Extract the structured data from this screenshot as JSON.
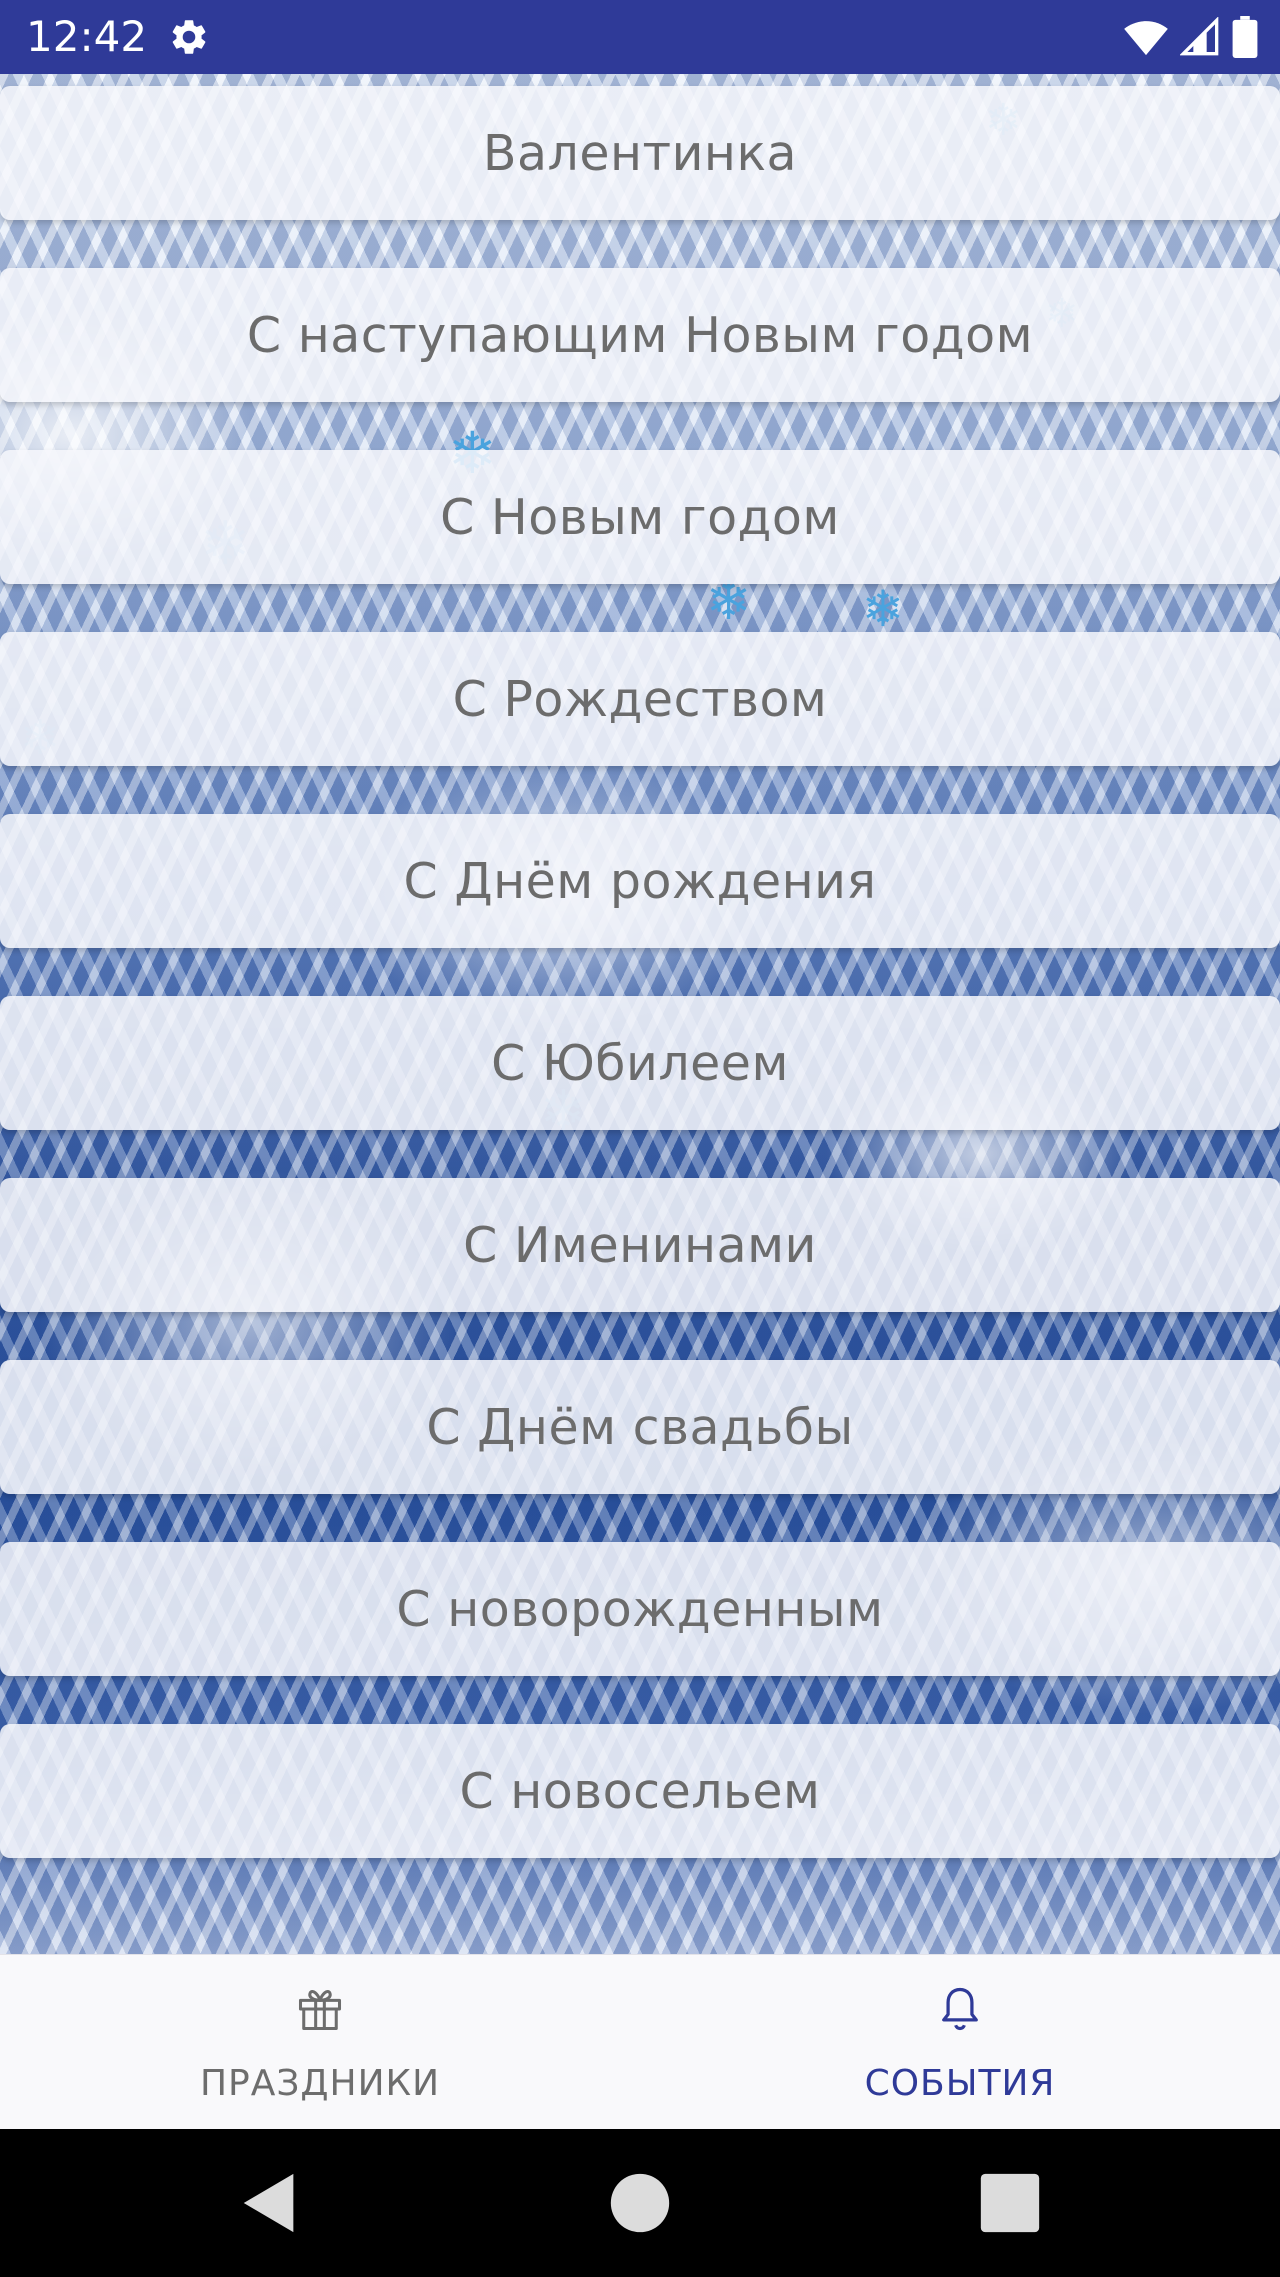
{
  "status_bar": {
    "time": "12:42",
    "settings_icon": "gear-icon",
    "wifi_icon": "wifi-icon",
    "signal_icon": "cellular-signal-icon",
    "battery_icon": "battery-icon",
    "background_color": "#2f3a98"
  },
  "list": {
    "items": [
      {
        "label": "Валентинка"
      },
      {
        "label": "С наступающим Новым годом"
      },
      {
        "label": "С Новым годом"
      },
      {
        "label": "С Рождеством"
      },
      {
        "label": "С Днём рождения"
      },
      {
        "label": "С Юбилеем"
      },
      {
        "label": "С Именинами"
      },
      {
        "label": "С Днём свадьбы"
      },
      {
        "label": "С новорожденным"
      },
      {
        "label": "С новосельем"
      }
    ]
  },
  "bottom_nav": {
    "tabs": [
      {
        "label": "ПРАЗДНИКИ",
        "icon": "gift-icon",
        "active": false
      },
      {
        "label": "СОБЫТИЯ",
        "icon": "bell-icon",
        "active": true
      }
    ],
    "active_color": "#2f3a98",
    "inactive_color": "#6d6d6d"
  },
  "system_nav": {
    "back_icon": "back-triangle-icon",
    "home_icon": "home-circle-icon",
    "recents_icon": "recents-square-icon"
  }
}
